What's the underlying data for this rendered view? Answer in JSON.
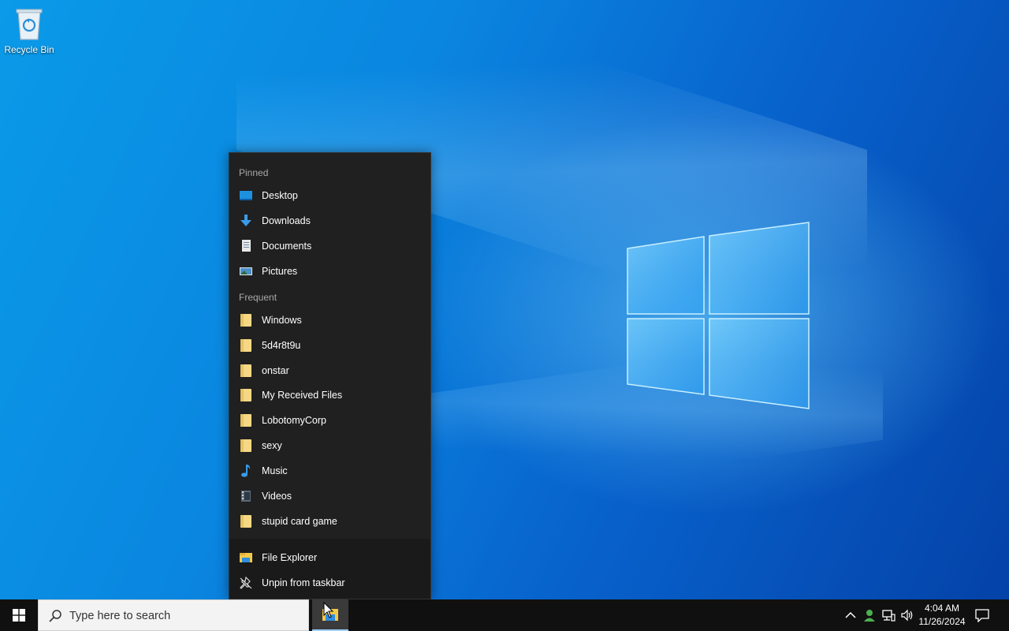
{
  "desktop": {
    "icons": [
      {
        "label": "Recycle Bin",
        "icon": "recycle-bin-icon"
      }
    ]
  },
  "jumplist": {
    "pinned_title": "Pinned",
    "pinned": [
      {
        "label": "Desktop",
        "icon": "desktop-icon"
      },
      {
        "label": "Downloads",
        "icon": "download-arrow-icon"
      },
      {
        "label": "Documents",
        "icon": "document-icon"
      },
      {
        "label": "Pictures",
        "icon": "pictures-icon"
      }
    ],
    "frequent_title": "Frequent",
    "frequent": [
      {
        "label": "Windows",
        "icon": "folder-icon"
      },
      {
        "label": "5d4r8t9u",
        "icon": "folder-icon"
      },
      {
        "label": "onstar",
        "icon": "folder-icon"
      },
      {
        "label": "My Received Files",
        "icon": "folder-icon"
      },
      {
        "label": "LobotomyCorp",
        "icon": "folder-icon"
      },
      {
        "label": "sexy",
        "icon": "folder-icon"
      },
      {
        "label": "Music",
        "icon": "music-note-icon"
      },
      {
        "label": "Videos",
        "icon": "video-icon"
      },
      {
        "label": "stupid card game",
        "icon": "folder-icon"
      }
    ],
    "tasks": [
      {
        "label": "File Explorer",
        "icon": "file-explorer-icon"
      },
      {
        "label": "Unpin from taskbar",
        "icon": "unpin-icon"
      }
    ]
  },
  "taskbar": {
    "search_placeholder": "Type here to search",
    "clock": {
      "time": "4:04 AM",
      "date": "11/26/2024"
    },
    "colors": {
      "taskbar_bg": "#101010",
      "accent": "#0078d7"
    }
  }
}
